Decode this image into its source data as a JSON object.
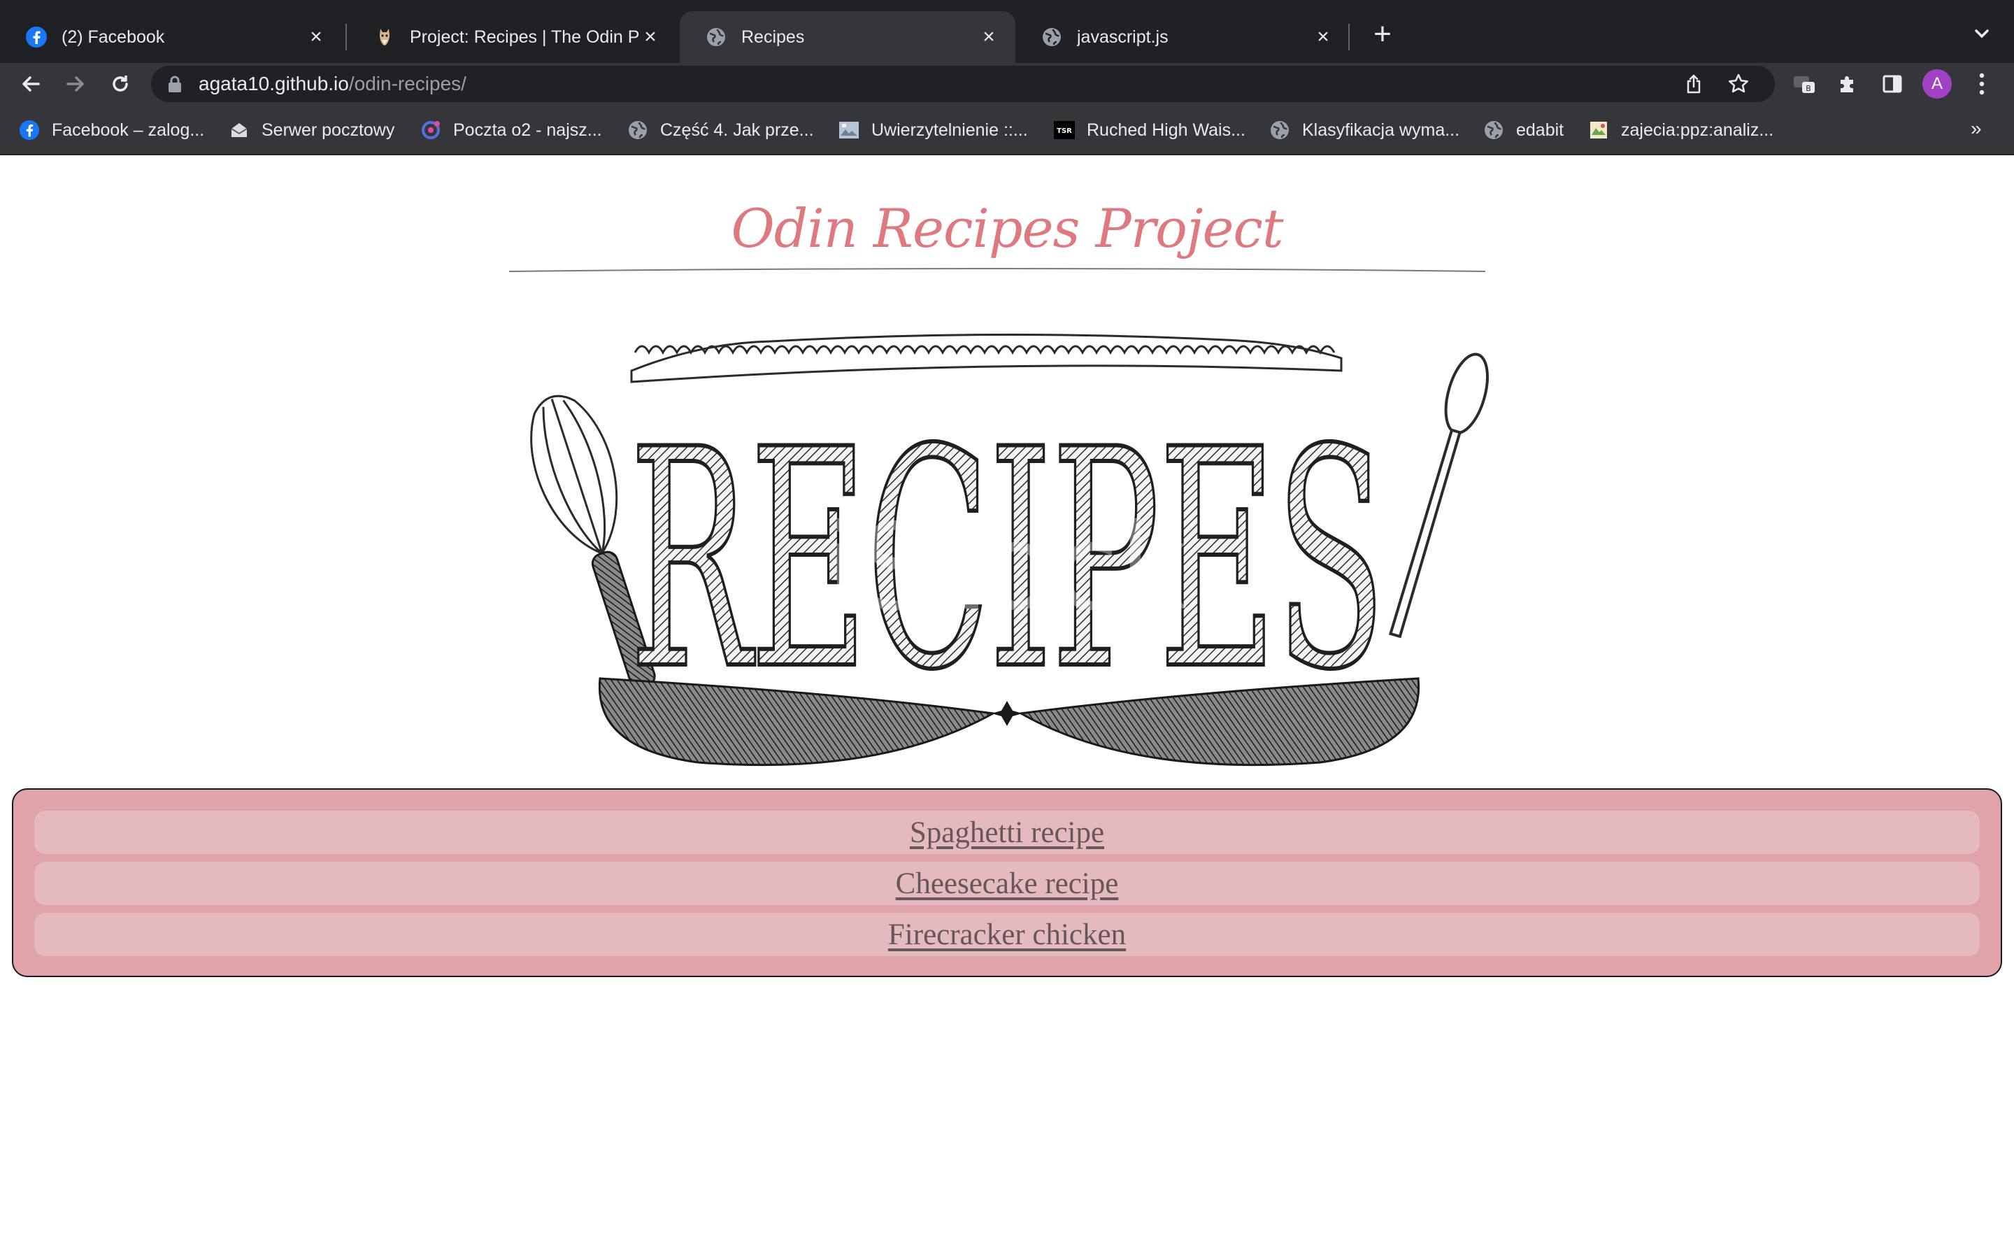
{
  "browser": {
    "tabs": [
      {
        "title": "(2) Facebook",
        "icon": "facebook-icon"
      },
      {
        "title": "Project: Recipes | The Odin Pro",
        "icon": "odin-icon"
      },
      {
        "title": "Recipes",
        "icon": "globe-icon",
        "active": true
      },
      {
        "title": "javascript.js",
        "icon": "globe-icon"
      }
    ],
    "url_host": "agata10.github.io",
    "url_path": "/odin-recipes/",
    "profile_initial": "A",
    "bookmarks": [
      {
        "label": "Facebook – zalog...",
        "icon": "facebook-icon"
      },
      {
        "label": "Serwer pocztowy",
        "icon": "mail-icon"
      },
      {
        "label": "Poczta o2 - najsz...",
        "icon": "o2-icon"
      },
      {
        "label": "Część 4. Jak prze...",
        "icon": "globe-icon"
      },
      {
        "label": "Uwierzytelnienie ::...",
        "icon": "site-icon"
      },
      {
        "label": "Ruched High Wais...",
        "icon": "tsr-icon"
      },
      {
        "label": "Klasyfikacja wyma...",
        "icon": "globe-icon"
      },
      {
        "label": "edabit",
        "icon": "globe-icon"
      },
      {
        "label": "zajecia:ppz:analiz...",
        "icon": "wiki-icon"
      }
    ],
    "bookmarks_more": "»",
    "colors": {
      "chrome_dark": "#202124",
      "chrome_mid": "#35363a",
      "avatar": "#a142c4"
    }
  },
  "page": {
    "title": "Odin Recipes Project",
    "hero_text": "RECIPES",
    "hero_watermark": "iStock",
    "links": [
      {
        "label": "Spaghetti recipe"
      },
      {
        "label": "Cheesecake recipe"
      },
      {
        "label": "Firecracker chicken"
      }
    ],
    "colors": {
      "title": "#de7a7f",
      "box": "#e0a3aa",
      "item": "#e4bac0",
      "link": "#66585a"
    }
  }
}
